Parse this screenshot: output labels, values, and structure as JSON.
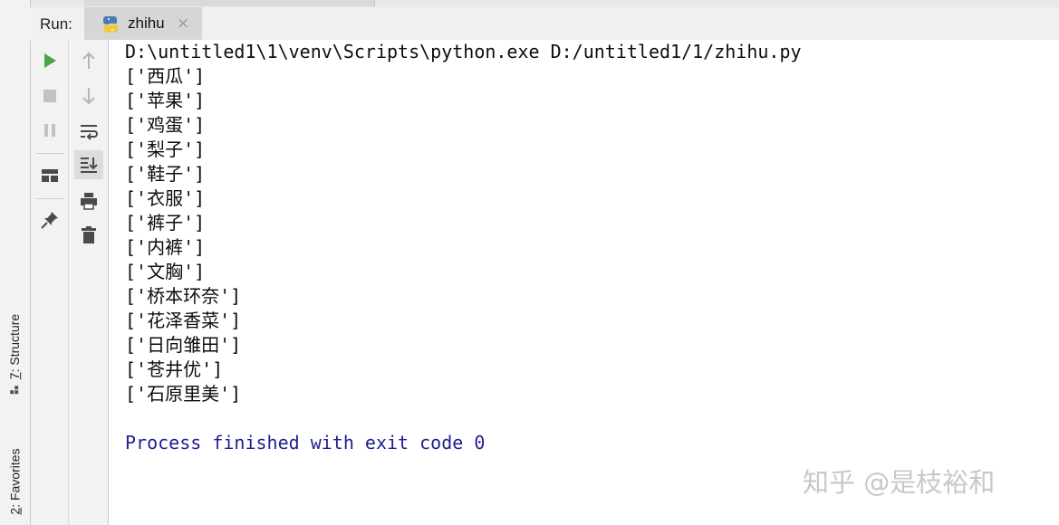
{
  "run_panel": {
    "label": "Run:",
    "tab_name": "zhihu",
    "tab_close": "×"
  },
  "left_strip": {
    "structure_label": "Structure",
    "structure_mnemonic": "7",
    "favorites_label": "Favorites",
    "favorites_mnemonic": "2"
  },
  "toolbar": {
    "rerun": "rerun-icon",
    "stop": "stop-icon",
    "pause": "pause-icon",
    "layout": "layout-icon",
    "pin": "pin-icon",
    "up": "arrow-up-icon",
    "down": "arrow-down-icon",
    "soft_wrap": "soft-wrap-icon",
    "scroll_to_end": "scroll-to-end-icon",
    "print": "print-icon",
    "clear": "trash-icon"
  },
  "console": {
    "command": "D:\\untitled1\\1\\venv\\Scripts\\python.exe D:/untitled1/1/zhihu.py",
    "lines": [
      "['西瓜']",
      "['苹果']",
      "['鸡蛋']",
      "['梨子']",
      "['鞋子']",
      "['衣服']",
      "['裤子']",
      "['内裤']",
      "['文胸']",
      "['桥本环奈']",
      "['花泽香菜']",
      "['日向雏田']",
      "['苍井优']",
      "['石原里美']"
    ],
    "exit_message": "Process finished with exit code 0"
  },
  "watermark": "知乎 @是枝裕和",
  "colors": {
    "run_green": "#4aa54a",
    "disabled_gray": "#a9a9a9",
    "exit_text": "#1f1f8f"
  }
}
